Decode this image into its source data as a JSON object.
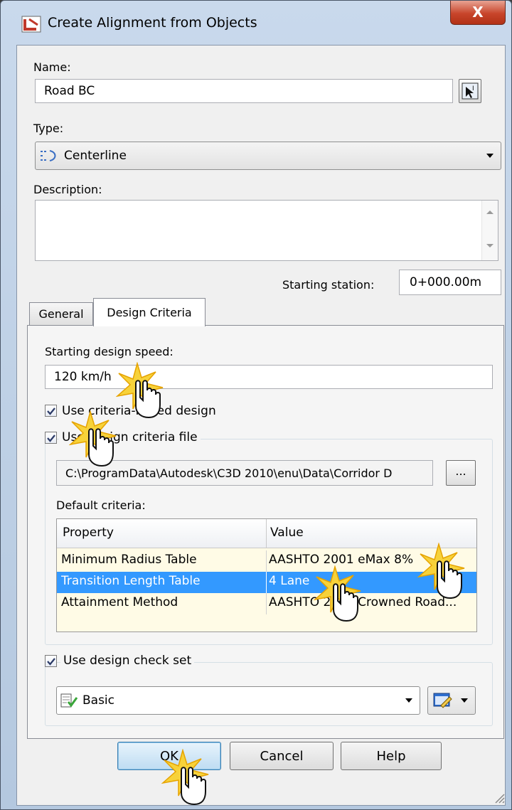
{
  "window": {
    "title": "Create Alignment from Objects",
    "close_label": "X"
  },
  "name": {
    "label": "Name:",
    "value": "Road BC"
  },
  "type": {
    "label": "Type:",
    "value": "Centerline"
  },
  "description": {
    "label": "Description:",
    "value": ""
  },
  "starting_station": {
    "label": "Starting station:",
    "value": "0+000.00m"
  },
  "tabs": [
    {
      "label": "General",
      "active": false
    },
    {
      "label": "Design Criteria",
      "active": true
    }
  ],
  "design_criteria": {
    "speed_label": "Starting design speed:",
    "speed_value": "120 km/h",
    "use_criteria_based_design": {
      "label": "Use criteria-based design",
      "checked": true
    },
    "use_design_criteria_file": {
      "label": "Use design criteria file",
      "checked": true
    },
    "criteria_file_path": "C:\\ProgramData\\Autodesk\\C3D 2010\\enu\\Data\\Corridor D",
    "browse_label": "...",
    "default_criteria_label": "Default criteria:",
    "grid": {
      "headers": [
        "Property",
        "Value"
      ],
      "rows": [
        {
          "property": "Minimum Radius Table",
          "value": "AASHTO 2001 eMax 8%",
          "selected": false
        },
        {
          "property": "Transition Length Table",
          "value": "4 Lane",
          "selected": true
        },
        {
          "property": "Attainment Method",
          "value": "AASHTO 2001 Crowned Road...",
          "selected": false
        }
      ]
    },
    "use_design_check_set": {
      "label": "Use design check set",
      "checked": true
    },
    "check_set_value": "Basic"
  },
  "buttons": {
    "ok": "OK",
    "cancel": "Cancel",
    "help": "Help"
  },
  "colors": {
    "selection": "#3399ff",
    "close_button": "#c8452b",
    "grid_background": "#fffbe6"
  }
}
